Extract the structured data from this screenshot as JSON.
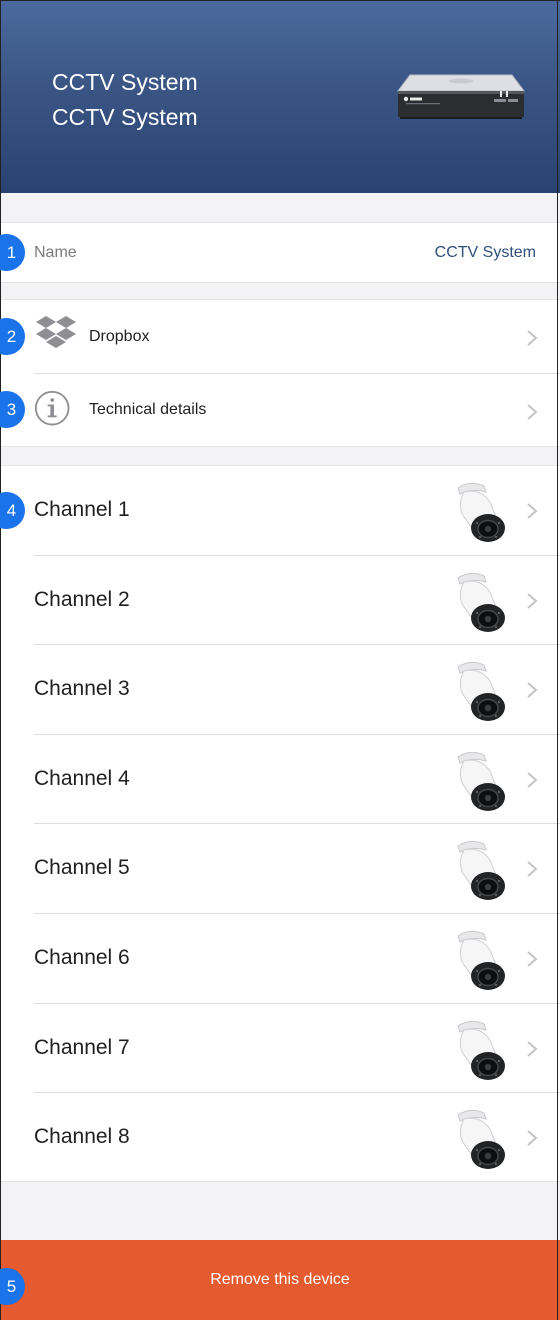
{
  "header": {
    "title_line1": "CCTV System",
    "title_line2": "CCTV System",
    "device_image": "dvr-recorder-image"
  },
  "name_row": {
    "label": "Name",
    "value": "CCTV System"
  },
  "menu": [
    {
      "label": "Dropbox",
      "icon": "dropbox-icon"
    },
    {
      "label": "Technical details",
      "icon": "info-icon"
    }
  ],
  "channels": [
    {
      "label": "Channel 1"
    },
    {
      "label": "Channel 2"
    },
    {
      "label": "Channel 3"
    },
    {
      "label": "Channel 4"
    },
    {
      "label": "Channel 5"
    },
    {
      "label": "Channel 6"
    },
    {
      "label": "Channel 7"
    },
    {
      "label": "Channel 8"
    }
  ],
  "remove_button": {
    "label": "Remove this device"
  },
  "badges": [
    "1",
    "2",
    "3",
    "4",
    "5"
  ],
  "colors": {
    "header_top": "#4a6a9e",
    "header_bottom": "#2a4270",
    "accent_blue": "#1a73e8",
    "name_value": "#2f4f7d",
    "remove_bg": "#e55a2f"
  }
}
